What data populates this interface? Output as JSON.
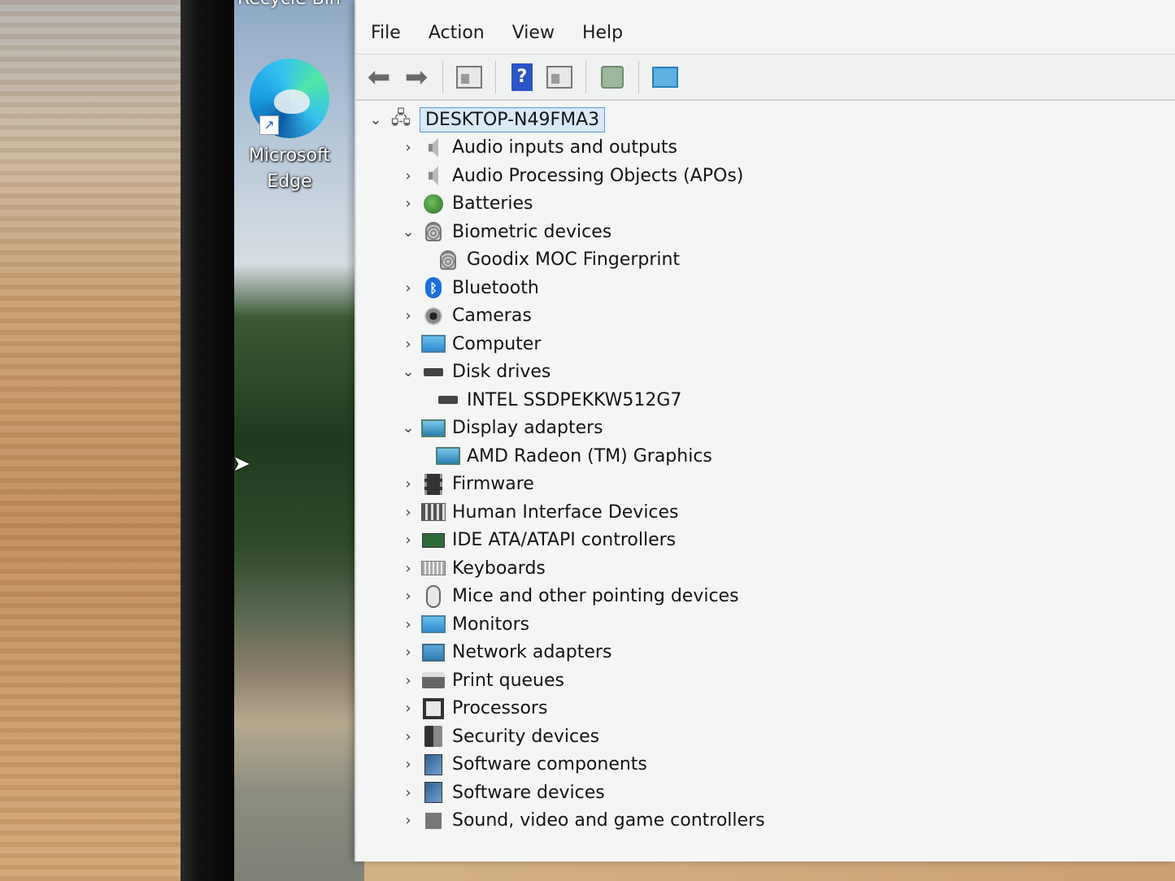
{
  "desktop": {
    "recycle_bin_label": "Recycle Bin",
    "edge_label_line1": "Microsoft",
    "edge_label_line2": "Edge"
  },
  "menu": {
    "file": "File",
    "action": "Action",
    "view": "View",
    "help": "Help"
  },
  "toolbar": {
    "back_icon": "back-arrow-icon",
    "forward_icon": "forward-arrow-icon",
    "help_glyph": "?"
  },
  "tree": {
    "root": "DESKTOP-N49FMA3",
    "items": [
      {
        "label": "Audio inputs and outputs",
        "expanded": false,
        "level": 1,
        "icon": "speaker-icon"
      },
      {
        "label": "Audio Processing Objects (APOs)",
        "expanded": false,
        "level": 1,
        "icon": "speaker-icon"
      },
      {
        "label": "Batteries",
        "expanded": false,
        "level": 1,
        "icon": "battery-icon"
      },
      {
        "label": "Biometric devices",
        "expanded": true,
        "level": 1,
        "icon": "fingerprint-icon"
      },
      {
        "label": "Goodix MOC Fingerprint",
        "level": 2,
        "icon": "fingerprint-icon"
      },
      {
        "label": "Bluetooth",
        "expanded": false,
        "level": 1,
        "icon": "bluetooth-icon"
      },
      {
        "label": "Cameras",
        "expanded": false,
        "level": 1,
        "icon": "camera-icon"
      },
      {
        "label": "Computer",
        "expanded": false,
        "level": 1,
        "icon": "computer-icon"
      },
      {
        "label": "Disk drives",
        "expanded": true,
        "level": 1,
        "icon": "disk-icon"
      },
      {
        "label": "INTEL SSDPEKKW512G7",
        "level": 2,
        "icon": "disk-icon"
      },
      {
        "label": "Display adapters",
        "expanded": true,
        "level": 1,
        "icon": "display-adapter-icon"
      },
      {
        "label": "AMD Radeon (TM) Graphics",
        "level": 2,
        "icon": "display-adapter-icon"
      },
      {
        "label": "Firmware",
        "expanded": false,
        "level": 1,
        "icon": "firmware-icon"
      },
      {
        "label": "Human Interface Devices",
        "expanded": false,
        "level": 1,
        "icon": "hid-icon"
      },
      {
        "label": "IDE ATA/ATAPI controllers",
        "expanded": false,
        "level": 1,
        "icon": "ide-controller-icon"
      },
      {
        "label": "Keyboards",
        "expanded": false,
        "level": 1,
        "icon": "keyboard-icon"
      },
      {
        "label": "Mice and other pointing devices",
        "expanded": false,
        "level": 1,
        "icon": "mouse-icon"
      },
      {
        "label": "Monitors",
        "expanded": false,
        "level": 1,
        "icon": "monitor-icon"
      },
      {
        "label": "Network adapters",
        "expanded": false,
        "level": 1,
        "icon": "network-adapter-icon"
      },
      {
        "label": "Print queues",
        "expanded": false,
        "level": 1,
        "icon": "printer-icon"
      },
      {
        "label": "Processors",
        "expanded": false,
        "level": 1,
        "icon": "processor-icon"
      },
      {
        "label": "Security devices",
        "expanded": false,
        "level": 1,
        "icon": "security-device-icon"
      },
      {
        "label": "Software components",
        "expanded": false,
        "level": 1,
        "icon": "software-component-icon"
      },
      {
        "label": "Software devices",
        "expanded": false,
        "level": 1,
        "icon": "software-device-icon"
      },
      {
        "label": "Sound, video and game controllers",
        "expanded": false,
        "level": 1,
        "icon": "sound-controller-icon"
      }
    ]
  }
}
